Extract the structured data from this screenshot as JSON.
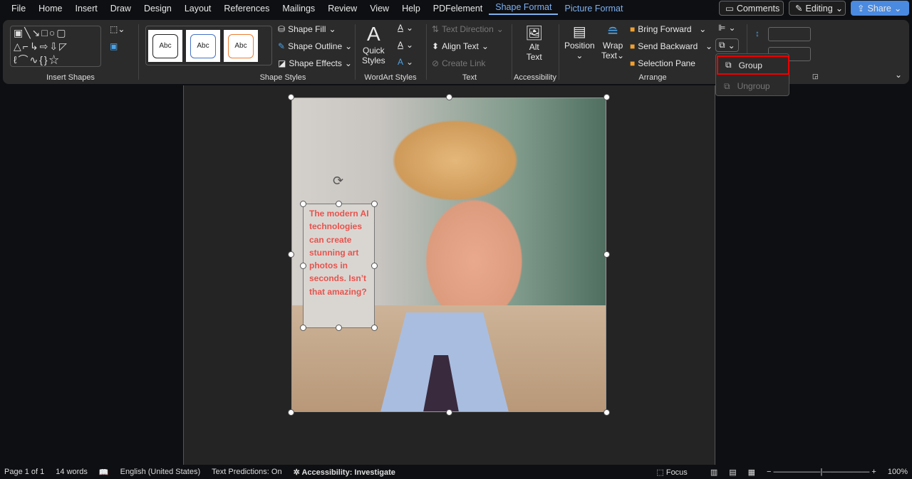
{
  "menu": {
    "tabs": [
      "File",
      "Home",
      "Insert",
      "Draw",
      "Design",
      "Layout",
      "References",
      "Mailings",
      "Review",
      "View",
      "Help",
      "PDFelement",
      "Shape Format",
      "Picture Format"
    ],
    "active": "Shape Format"
  },
  "top": {
    "comments": "Comments",
    "editing": "Editing",
    "share": "Share"
  },
  "ribbon": {
    "insert_shapes": "Insert Shapes",
    "shape_styles": {
      "label": "Shape Styles",
      "sample": "Abc",
      "fill": "Shape Fill",
      "outline": "Shape Outline",
      "effects": "Shape Effects"
    },
    "wordart": {
      "label": "WordArt Styles",
      "quick1": "Quick",
      "quick2": "Styles"
    },
    "text": {
      "label": "Text",
      "direction": "Text Direction",
      "align": "Align Text",
      "link": "Create Link"
    },
    "accessibility": {
      "label": "Accessibility",
      "alt1": "Alt",
      "alt2": "Text"
    },
    "arrange": {
      "label": "Arrange",
      "position": "Position",
      "wrap1": "Wrap",
      "wrap2": "Text",
      "bring": "Bring Forward",
      "send": "Send Backward",
      "selection": "Selection Pane"
    }
  },
  "group_menu": {
    "group": "Group",
    "ungroup": "Ungroup"
  },
  "textbox": {
    "text": "The modern AI technologies can create stunning art photos in seconds. Isn’t that amazing?"
  },
  "status": {
    "page": "Page 1 of 1",
    "words": "14 words",
    "language": "English (United States)",
    "predictions": "Text Predictions: On",
    "accessibility": "Accessibility: Investigate",
    "focus": "Focus",
    "zoom": "100%"
  }
}
